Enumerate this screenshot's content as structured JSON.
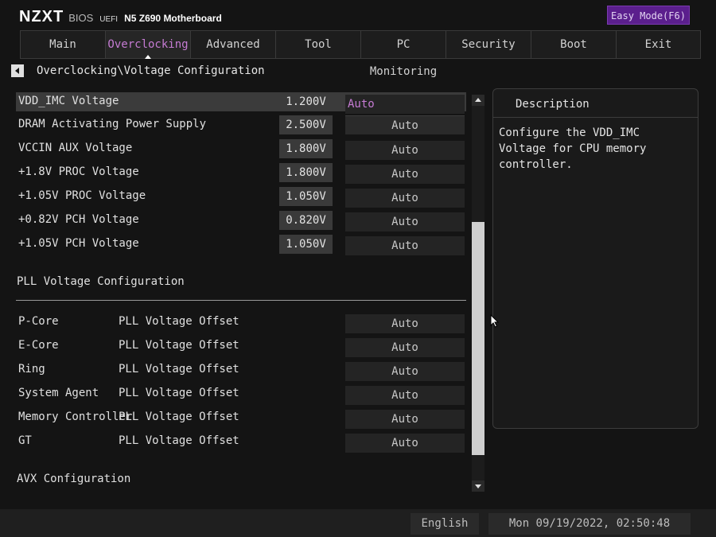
{
  "header": {
    "brand": "NZXT",
    "bios_label": "BIOS",
    "uefi_label": "UEFI",
    "board": "N5 Z690 Motherboard",
    "easy_mode": "Easy Mode(F6)"
  },
  "tabs": [
    {
      "label": "Main"
    },
    {
      "label": "Overclocking",
      "active": true
    },
    {
      "label": "Advanced"
    },
    {
      "label": "Tool"
    },
    {
      "label": "PC Monitoring"
    },
    {
      "label": "Security"
    },
    {
      "label": "Boot"
    },
    {
      "label": "Exit"
    }
  ],
  "breadcrumb": "Overclocking\\Voltage Configuration",
  "voltage_rows": [
    {
      "label": "VDD_IMC Voltage",
      "value": "1.200V",
      "option": "Auto",
      "selected": true
    },
    {
      "label": "DRAM Activating Power Supply",
      "value": "2.500V",
      "option": "Auto"
    },
    {
      "label": "VCCIN AUX Voltage",
      "value": "1.800V",
      "option": "Auto"
    },
    {
      "label": "+1.8V PROC Voltage",
      "value": "1.800V",
      "option": "Auto"
    },
    {
      "label": "+1.05V PROC Voltage",
      "value": "1.050V",
      "option": "Auto"
    },
    {
      "label": "+0.82V PCH Voltage",
      "value": "0.820V",
      "option": "Auto"
    },
    {
      "label": "+1.05V PCH Voltage",
      "value": "1.050V",
      "option": "Auto"
    }
  ],
  "pll_section_title": "PLL Voltage Configuration",
  "pll_rows": [
    {
      "label": "P-Core",
      "sub": "PLL Voltage Offset",
      "option": "Auto"
    },
    {
      "label": "E-Core",
      "sub": "PLL Voltage Offset",
      "option": "Auto"
    },
    {
      "label": "Ring",
      "sub": "PLL Voltage Offset",
      "option": "Auto"
    },
    {
      "label": "System Agent",
      "sub": "PLL Voltage Offset",
      "option": "Auto"
    },
    {
      "label": "Memory Controller",
      "sub": "PLL Voltage Offset",
      "option": "Auto"
    },
    {
      "label": "GT",
      "sub": "PLL Voltage Offset",
      "option": "Auto"
    }
  ],
  "avx_section_title": "AVX Configuration",
  "description": {
    "title": "Description",
    "text": "Configure the VDD_IMC Voltage for CPU memory controller."
  },
  "footer": {
    "language": "English",
    "datetime": "Mon 09/19/2022, 02:50:48"
  },
  "colors": {
    "accent": "#c57bd3",
    "easy_mode_bg": "#5b1f8d",
    "background": "#141414"
  }
}
